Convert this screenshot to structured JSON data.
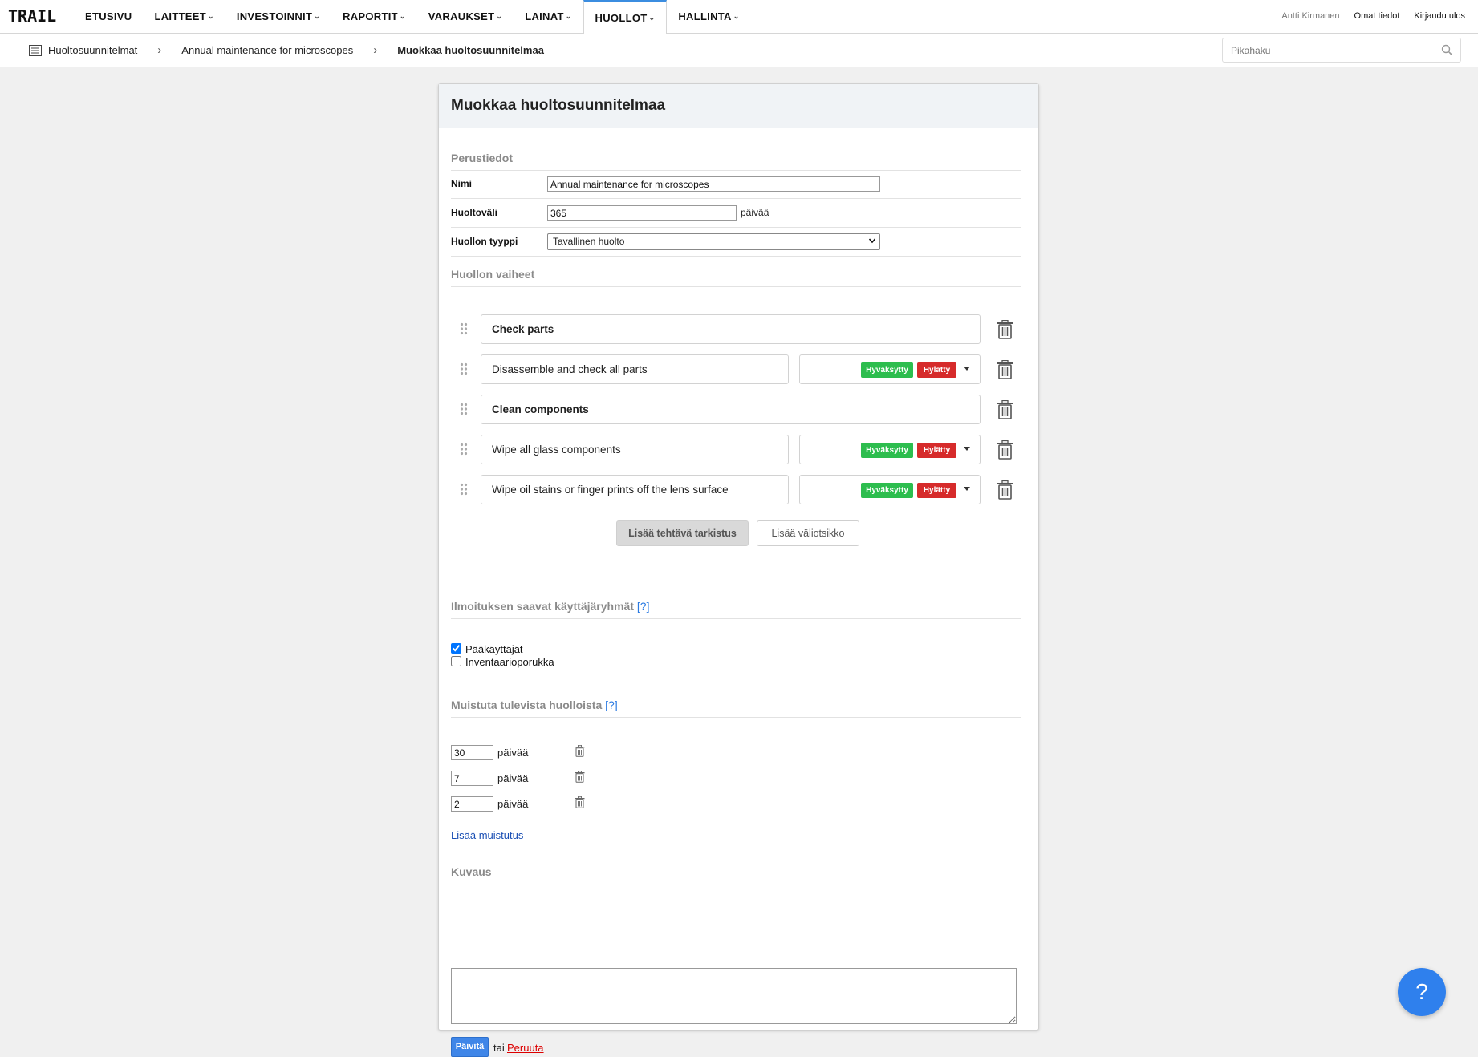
{
  "brand": "TRAIL",
  "nav": {
    "items": [
      {
        "label": "ETUSIVU",
        "has_dropdown": false,
        "active": false
      },
      {
        "label": "LAITTEET",
        "has_dropdown": true,
        "active": false
      },
      {
        "label": "INVESTOINNIT",
        "has_dropdown": true,
        "active": false
      },
      {
        "label": "RAPORTIT",
        "has_dropdown": true,
        "active": false
      },
      {
        "label": "VARAUKSET",
        "has_dropdown": true,
        "active": false
      },
      {
        "label": "LAINAT",
        "has_dropdown": true,
        "active": false
      },
      {
        "label": "HUOLLOT",
        "has_dropdown": true,
        "active": true
      },
      {
        "label": "HALLINTA",
        "has_dropdown": true,
        "active": false
      }
    ],
    "user_name": "Antti Kirmanen",
    "profile_link": "Omat tiedot",
    "logout_link": "Kirjaudu ulos"
  },
  "breadcrumb": {
    "root": "Huoltosuunnitelmat",
    "parent": "Annual maintenance for microscopes",
    "current": "Muokkaa huoltosuunnitelmaa"
  },
  "search": {
    "placeholder": "Pikahaku"
  },
  "form": {
    "title": "Muokkaa huoltosuunnitelmaa",
    "basic_section": "Perustiedot",
    "name_label": "Nimi",
    "name_value": "Annual maintenance for microscopes",
    "interval_label": "Huoltoväli",
    "interval_value": "365",
    "interval_unit": "päivää",
    "type_label": "Huollon tyyppi",
    "type_value": "Tavallinen huolto",
    "steps_section": "Huollon vaiheet",
    "steps": [
      {
        "kind": "header",
        "text": "Check parts"
      },
      {
        "kind": "task",
        "text": "Disassemble and check all parts",
        "ok": "Hyväksytty",
        "fail": "Hylätty"
      },
      {
        "kind": "header",
        "text": "Clean components"
      },
      {
        "kind": "task",
        "text": "Wipe all glass components",
        "ok": "Hyväksytty",
        "fail": "Hylätty"
      },
      {
        "kind": "task",
        "text": "Wipe oil stains or finger prints off the lens surface",
        "ok": "Hyväksytty",
        "fail": "Hylätty"
      }
    ],
    "add_task_button": "Lisää tehtävä tarkistus",
    "add_subheading_button": "Lisää väliotsikko",
    "notify_section": "Ilmoituksen saavat käyttäjäryhmät",
    "help_marker": "[?]",
    "groups": [
      {
        "label": "Pääkäyttäjät",
        "checked": true
      },
      {
        "label": "Inventaarioporukka",
        "checked": false
      }
    ],
    "remind_section": "Muistuta tulevista huolloista",
    "reminders": [
      {
        "value": "30",
        "unit": "päivää"
      },
      {
        "value": "7",
        "unit": "päivää"
      },
      {
        "value": "2",
        "unit": "päivää"
      }
    ],
    "add_reminder_link": "Lisää muistutus",
    "description_section": "Kuvaus",
    "description_value": "",
    "save_button": "Päivitä",
    "or_text": "tai",
    "cancel_link": "Peruuta"
  },
  "help_button": "?",
  "colors": {
    "accent": "#3b8de0",
    "approved": "#2dbd4e",
    "rejected": "#d62b2b",
    "save": "#3f86e8",
    "fab": "#2f80ed"
  }
}
